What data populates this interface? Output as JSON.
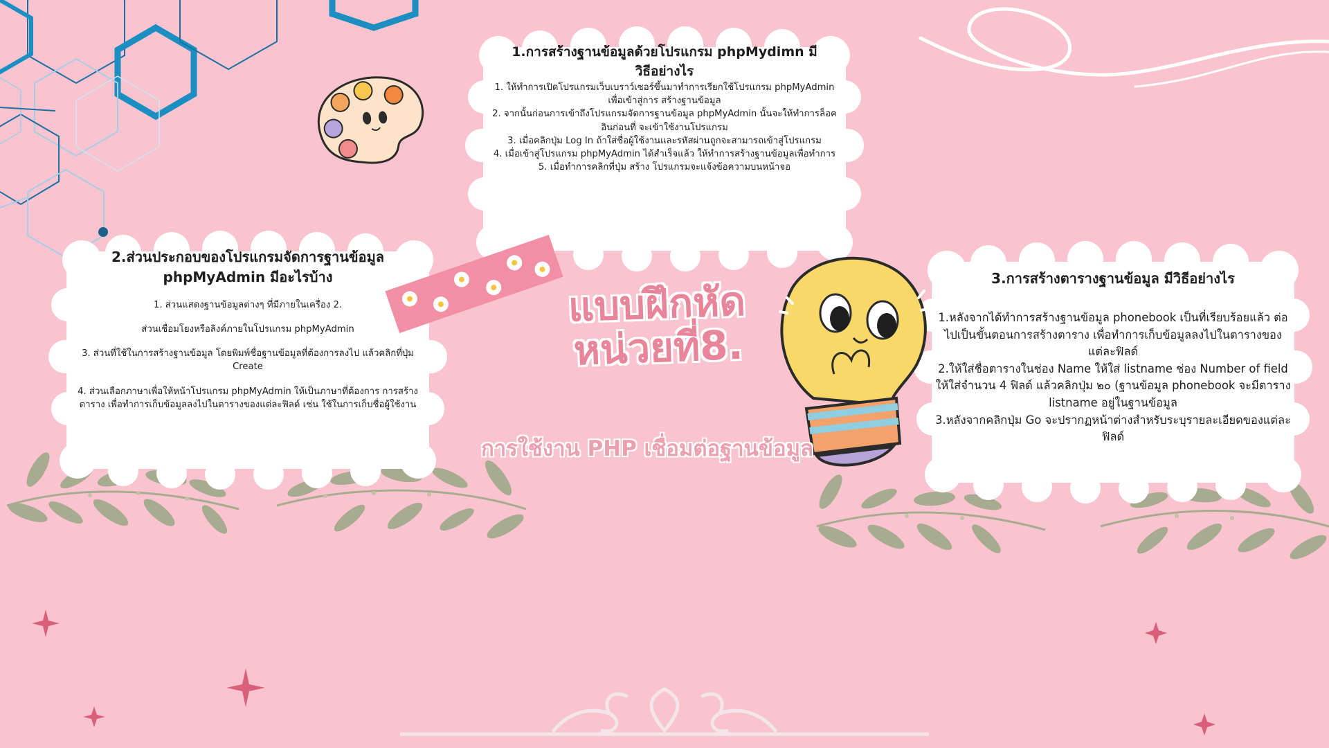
{
  "title": {
    "line1": "แบบฝึกหัด",
    "line2": "หน่วยที่8."
  },
  "subtitle": "การใช้งาน PHP เชื่อมต่อฐานข้อมูล",
  "cards": {
    "c1": {
      "heading": "1.การสร้างฐานข้อมูลด้วยโปรแกรม phpMydimn มีวิธีอย่างไร",
      "lines": [
        "1. ให้ทำการเปิดโปรแกรมเว็บเบราว์เซอร์ขึ้นมาทำการเรียกใช้โปรแกรม phpMyAdmin เพื่อเข้าสู่การ สร้างฐานข้อมูล",
        "2. จากนั้นก่อนการเข้าถึงโปรแกรมจัดการฐานข้อมูล phpMyAdmin นั้นจะให้ทำการล็อคอินก่อนที่ จะเข้าใช้งานโปรแกรม",
        "3. เมื่อคลิกปุ่ม Log In ถ้าใส่ชื่อผู้ใช้งานและรหัสผ่านถูกจะสามารถเข้าสู่โปรแกรม",
        "4. เมื่อเข้าสู่โปรแกรม phpMyAdmin ได้สำเร็จแล้ว ให้ทำการสร้างฐานข้อมูลเพื่อทำการ",
        "5. เมื่อทำการคลิกที่ปุ่ม สร้าง โปรแกรมจะแจ้งข้อความบนหน้าจอ"
      ]
    },
    "c2": {
      "heading": "2.ส่วนประกอบของโปรแกรมจัดการฐานข้อมูล phpMyAdmin มีอะไรบ้าง",
      "lines": [
        "1. ส่วนแสดงฐานข้อมูลต่างๆ ที่มีภายในเครื่อง 2.",
        "ส่วนเชื่อมโยงหรือลิงค์ภายในโปรแกรม phpMyAdmin",
        "3. ส่วนที่ใช้ในการสร้างฐานข้อมูล โดยพิมพ์ชื่อฐานข้อมูลที่ต้องการลงไป แล้วคลิกที่ปุ่ม Create",
        "4. ส่วนเลือกภาษาเพื่อให้หน้าโปรแกรม phpMyAdmin ให้เป็นภาษาที่ต้องการ การสร้างตาราง เพื่อทำการเก็บข้อมูลลงไปในตารางของแต่ละฟิลด์ เช่น ใช้ในการเก็บชื่อผู้ใช้งาน"
      ]
    },
    "c3": {
      "heading": "3.การสร้างตารางฐานข้อมูล มีวิธีอย่างไร",
      "lines": [
        "1.หลังจากได้ทำการสร้างฐานข้อมูล phonebook เป็นที่เรียบร้อยแล้ว ต่อไปเป็นขั้นตอนการสร้างตาราง เพื่อทำการเก็บข้อมูลลงไปในตารางของแต่ละฟิลด์",
        "2.ให้ใส่ชื่อตารางในช่อง Name ให้ใส่ listname ช่อง Number of field ให้ใส่จำนวน 4 ฟิลด์ แล้วคลิกปุ่ม ๒๐ (ฐานข้อมูล phonebook จะมีตาราง listname อยู่ในฐานข้อมูล",
        "3.หลังจากคลิกปุ่ม Go จะปรากฏหน้าต่างสำหรับระบุรายละเอียดของแต่ละฟิลด์"
      ]
    }
  },
  "colors": {
    "background": "#f9c4cf",
    "hexagon_dark": "#1b8ec2",
    "hexagon_light": "#a8cde6",
    "title_pink": "#e8859a",
    "leaf_green": "#a7ab8f",
    "sparkle_pink": "#d9607a",
    "bulb_yellow": "#f9d86a"
  },
  "decorations": [
    "hexagon-pattern",
    "palette-sticker",
    "washi-tape",
    "lightbulb-sticker",
    "leaf-branch",
    "sparkle",
    "swirl",
    "floral-ornament"
  ]
}
